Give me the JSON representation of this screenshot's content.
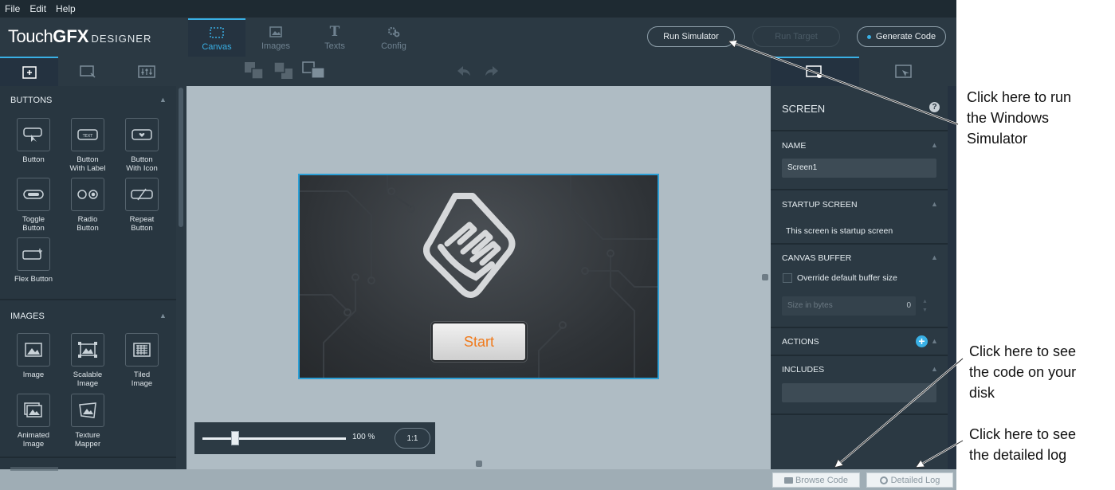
{
  "menu": [
    "File",
    "Edit",
    "Help"
  ],
  "logo": {
    "part1": "Touch",
    "part2": "GFX",
    "part3": "DESIGNER"
  },
  "main_tabs": [
    {
      "label": "Canvas",
      "icon": "canvas-icon"
    },
    {
      "label": "Images",
      "icon": "image-icon"
    },
    {
      "label": "Texts",
      "icon": "text-icon"
    },
    {
      "label": "Config",
      "icon": "gears-icon"
    }
  ],
  "header_buttons": {
    "run_simulator": "Run Simulator",
    "run_target": "Run Target",
    "generate_code": "Generate Code"
  },
  "widget_panel": {
    "buttons_title": "BUTTONS",
    "buttons": [
      "Button",
      "Button\nWith Label",
      "Button\nWith Icon",
      "Toggle\nButton",
      "Radio\nButton",
      "Repeat\nButton",
      "Flex Button"
    ],
    "images_title": "IMAGES",
    "images": [
      "Image",
      "Scalable\nImage",
      "Tiled\nImage",
      "Animated\nImage",
      "Texture\nMapper"
    ]
  },
  "canvas": {
    "start_label": "Start",
    "zoom_value": "100 %",
    "zoom_reset": "1:1",
    "zoom_fraction": 0.23
  },
  "properties": {
    "screen_title": "SCREEN",
    "name_title": "NAME",
    "name_value": "Screen1",
    "startup_title": "STARTUP SCREEN",
    "startup_text": "This screen is startup screen",
    "buffer_title": "CANVAS BUFFER",
    "buffer_checkbox": "Override default buffer size",
    "buffer_placeholder": "Size in bytes",
    "buffer_value": "0",
    "actions_title": "ACTIONS",
    "includes_title": "INCLUDES"
  },
  "bottom": {
    "browse_code": "Browse Code",
    "detailed_log": "Detailed Log"
  },
  "annotations": {
    "simulator": "Click here to run\nthe Windows\nSimulator",
    "code": "Click here to see\nthe code on your\ndisk",
    "log": "Click here to see\nthe detailed log"
  },
  "colors": {
    "accent": "#39b0e5",
    "start_text": "#f07a1c",
    "canvas_bg": "#afbcc4",
    "panel_bg": "#2b3943"
  }
}
